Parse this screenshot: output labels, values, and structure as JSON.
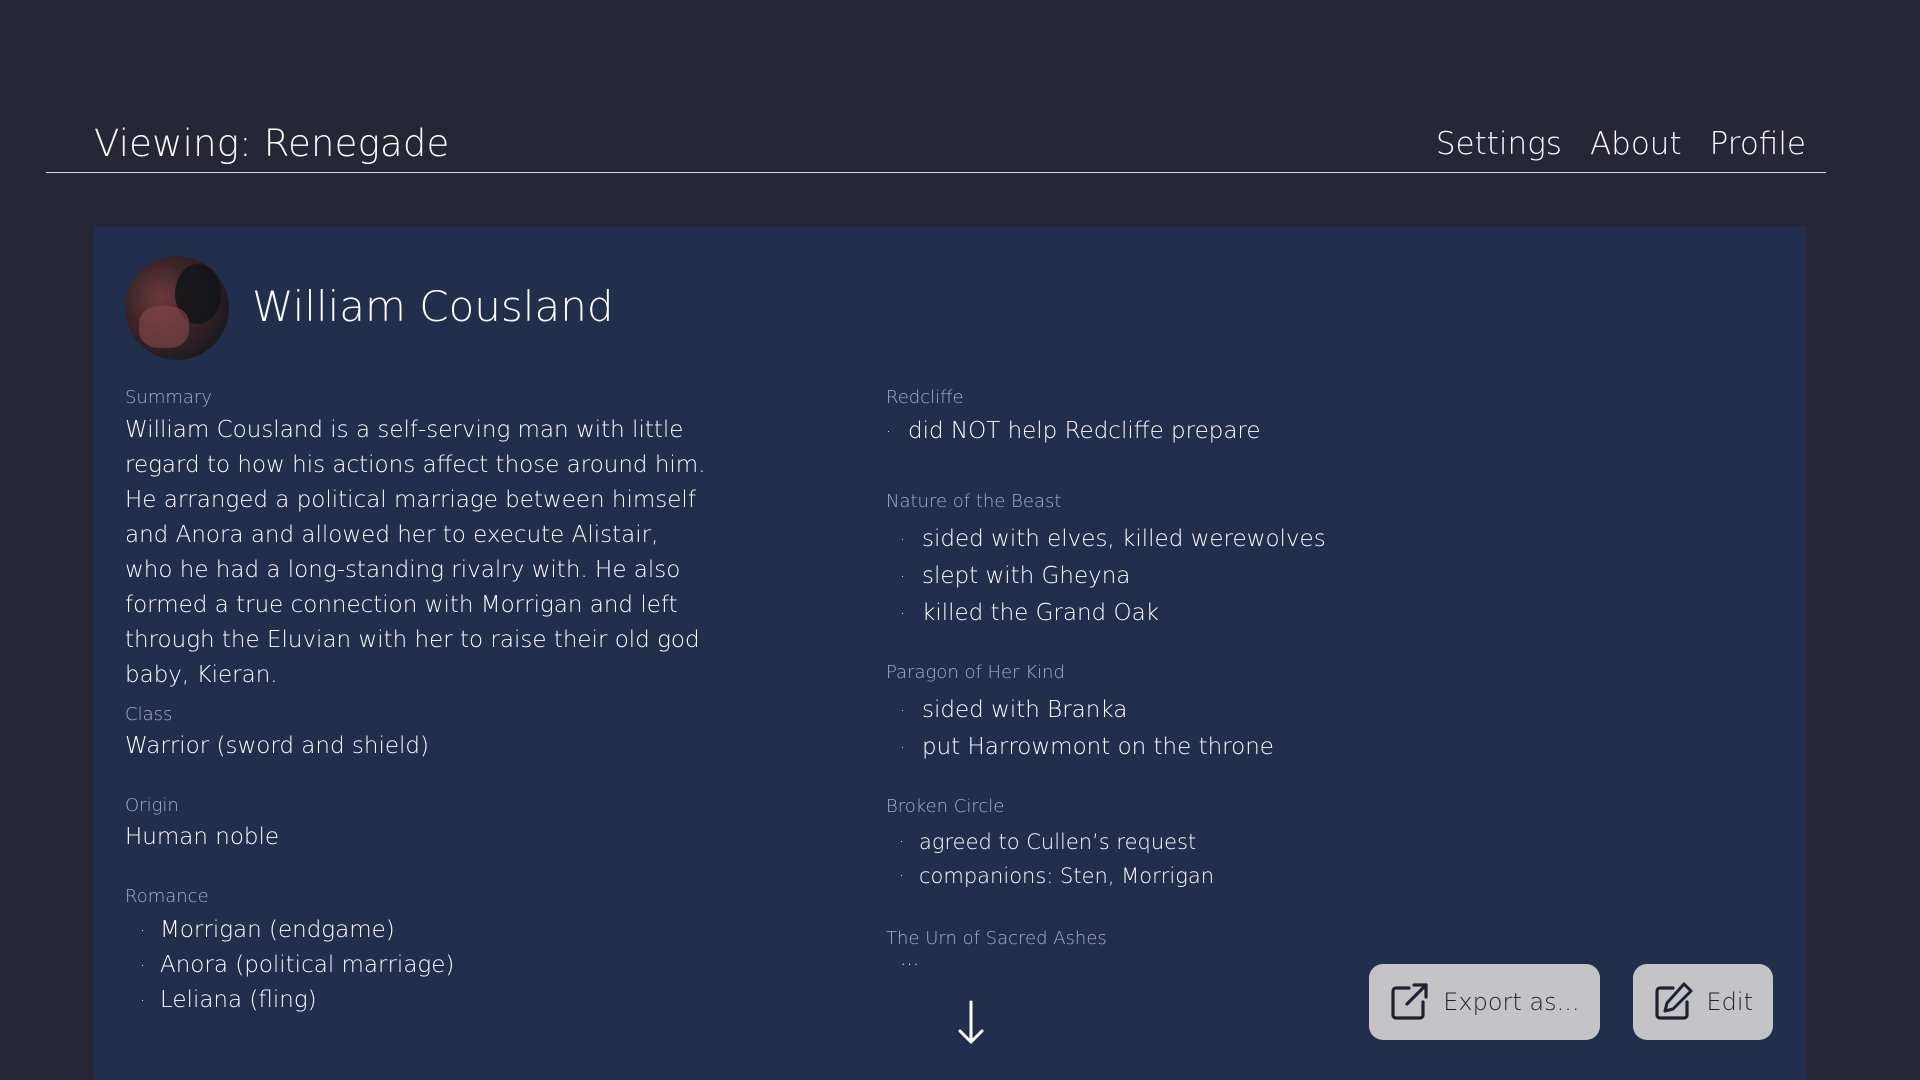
{
  "header": {
    "title": "Viewing: Renegade",
    "nav": [
      "Settings",
      "About",
      "Profile"
    ]
  },
  "character": {
    "name": "William Cousland",
    "summary_label": "Summary",
    "summary": "William Cousland is a self-serving man with little regard to how his actions affect those around him. He arranged a political marriage between himself and Anora and allowed her to execute Alistair, who he had a long-standing rivalry with. He also formed a true connection with Morrigan and left through the Eluvian with her to raise their old god baby, Kieran.",
    "class_label": "Class",
    "class": "Warrior (sword and shield)",
    "origin_label": "Origin",
    "origin": "Human noble",
    "romance_label": "Romance",
    "romance": [
      "Morrigan (endgame)",
      "Anora (political marriage)",
      "Leliana (fling)"
    ]
  },
  "quests": [
    {
      "title": "Redcliffe",
      "items": [
        "did NOT help Redcliffe prepare"
      ]
    },
    {
      "title": "Nature of the Beast",
      "items": [
        "sided with elves, killed werewolves",
        "slept with Gheyna",
        "killed the Grand Oak"
      ]
    },
    {
      "title": "Paragon of Her Kind",
      "items": [
        "sided with Branka",
        "put Harrowmont on the throne"
      ]
    },
    {
      "title": "Broken Circle",
      "items": [
        "agreed to Cullen’s request",
        "companions: Sten, Morrigan"
      ]
    },
    {
      "title": "The Urn of Sacred Ashes",
      "items": [
        "..."
      ]
    }
  ],
  "actions": {
    "export_label": "Export as...",
    "edit_label": "Edit"
  },
  "icons": {
    "export": "external-link-icon",
    "edit": "pencil-square-icon",
    "scroll": "arrow-down-icon"
  }
}
